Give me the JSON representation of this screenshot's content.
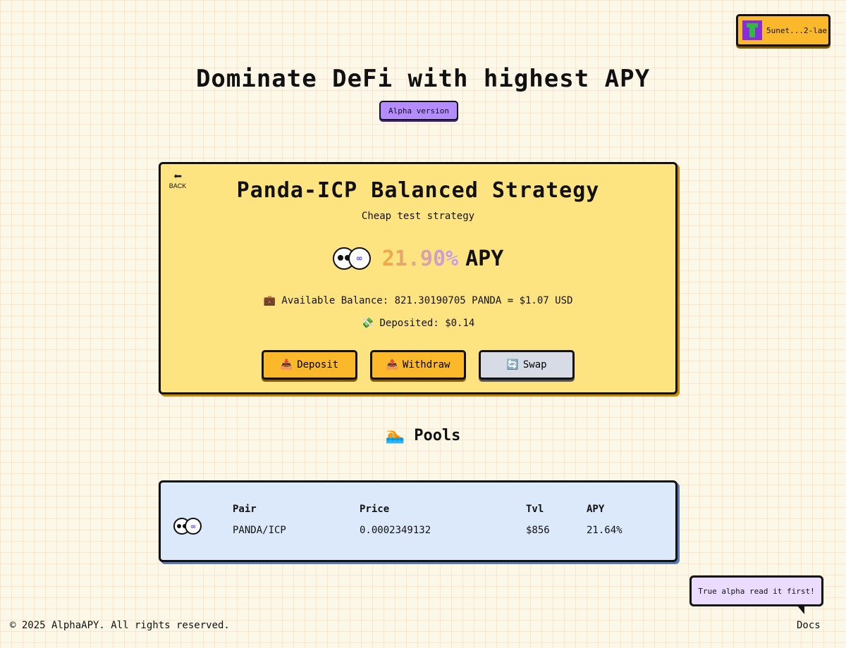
{
  "wallet": {
    "label": "5unet...2-lae"
  },
  "hero": {
    "title": "Dominate DeFi with highest APY",
    "badge": "Alpha version"
  },
  "strategy": {
    "back_label": "BACK",
    "title": "Panda-ICP Balanced Strategy",
    "subtitle": "Cheap test strategy",
    "apy_value": "21.90%",
    "apy_label": "APY",
    "balance_text": "💼 Available Balance: 821.30190705 PANDA = $1.07 USD",
    "deposited_text": "💸 Deposited: $0.14",
    "actions": {
      "deposit": "Deposit",
      "withdraw": "Withdraw",
      "swap": "Swap"
    }
  },
  "pools": {
    "heading": "🏊 Pools",
    "columns": {
      "pair": "Pair",
      "price": "Price",
      "tvl": "Tvl",
      "apy": "APY"
    },
    "rows": [
      {
        "pair": "PANDA/ICP",
        "price": "0.0002349132",
        "tvl": "$856",
        "apy": "21.64%"
      }
    ]
  },
  "bubble": {
    "text": "True alpha read it first!"
  },
  "footer": {
    "copyright": "© 2025 AlphaAPY. All rights reserved.",
    "docs": "Docs"
  },
  "colors": {
    "accent": "#fbb82a",
    "card_yellow": "#fde480",
    "card_blue": "#dbe9fb",
    "badge_purple": "#b48cff",
    "bubble_lilac": "#ebdcff"
  }
}
